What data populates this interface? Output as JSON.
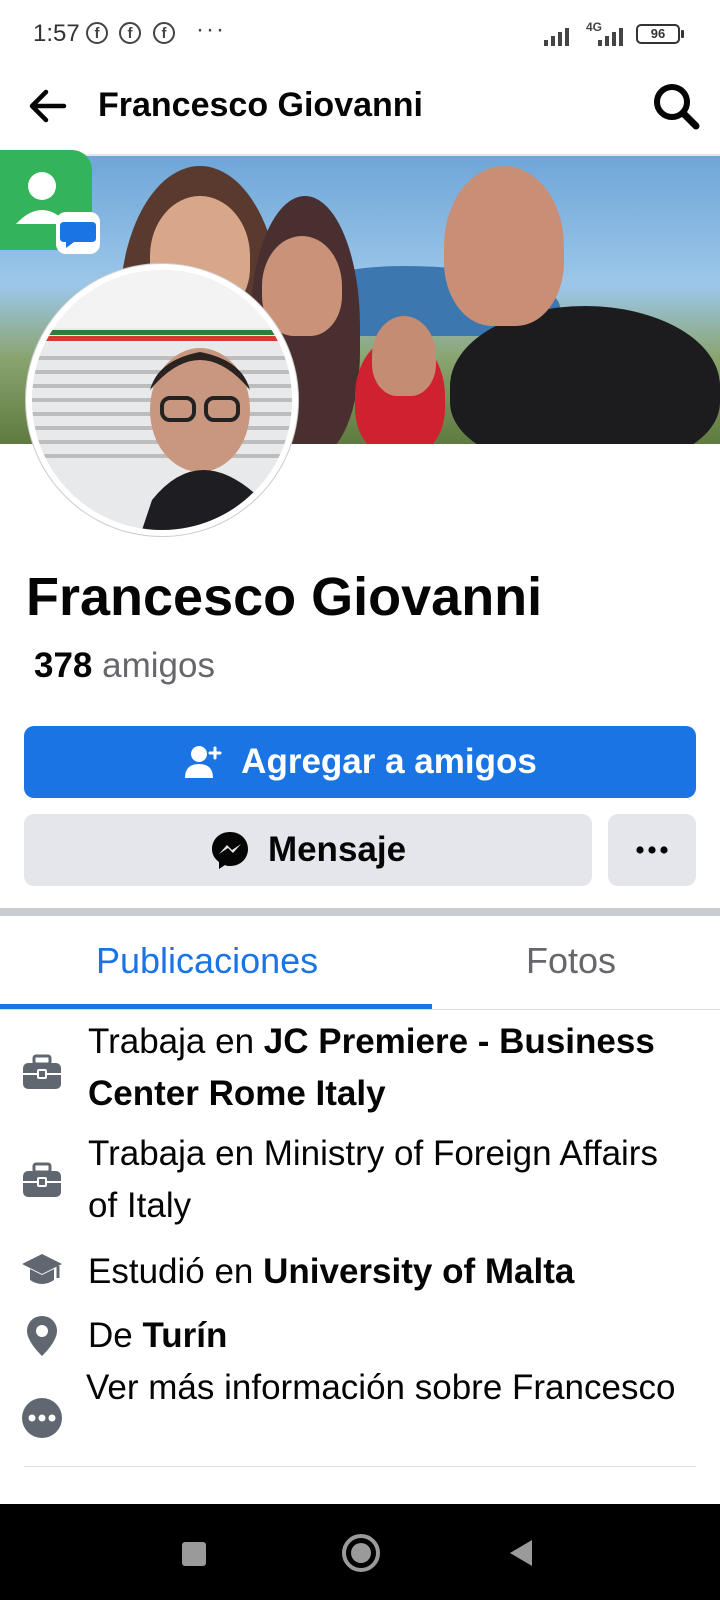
{
  "status_bar": {
    "time": "1:57",
    "notification_icons": [
      "facebook-icon",
      "facebook-icon",
      "facebook-icon"
    ],
    "more": "···",
    "network": "4G",
    "battery": "96"
  },
  "header": {
    "title": "Francesco Giovanni"
  },
  "profile": {
    "name": "Francesco Giovanni",
    "friends_count": "378",
    "friends_label": "amigos"
  },
  "actions": {
    "add_friend": "Agregar a amigos",
    "message": "Mensaje",
    "more": "···"
  },
  "tabs": [
    {
      "label": "Publicaciones",
      "active": true
    },
    {
      "label": "Fotos",
      "active": false
    }
  ],
  "info": [
    {
      "icon": "briefcase-icon",
      "prefix": "Trabaja en ",
      "bold": "JC Premiere  - Business Center Rome Italy"
    },
    {
      "icon": "briefcase-icon",
      "prefix": "Trabaja en Ministry of Foreign Affairs of Italy",
      "bold": ""
    },
    {
      "icon": "graduation-cap-icon",
      "prefix": "Estudió en ",
      "bold": "University of Malta"
    },
    {
      "icon": "location-pin-icon",
      "prefix": "De ",
      "bold": "Turín"
    },
    {
      "icon": "more-dots-icon",
      "prefix": "Ver más información sobre Francesco",
      "bold": ""
    }
  ],
  "colors": {
    "accent": "#1b74e4",
    "secondary_button": "#e4e6eb",
    "muted_text": "#65676b"
  }
}
